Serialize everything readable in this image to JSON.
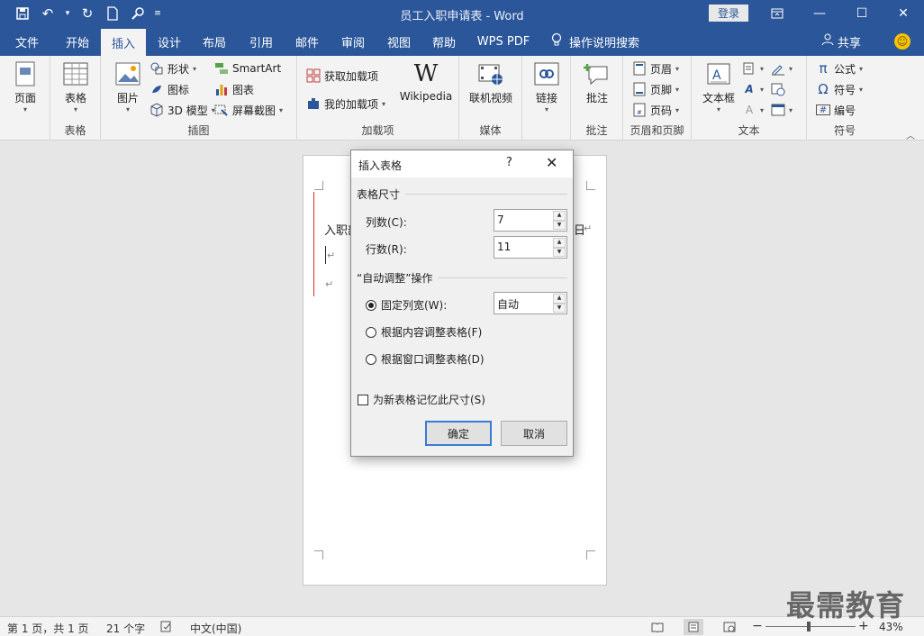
{
  "window": {
    "title": "员工入职申请表 - Word",
    "login_label": "登录"
  },
  "ribbon_tabs": [
    "文件",
    "开始",
    "插入",
    "设计",
    "布局",
    "引用",
    "邮件",
    "审阅",
    "视图",
    "帮助",
    "WPS PDF"
  ],
  "tell_me": "操作说明搜索",
  "share_label": "共享",
  "ribbon": {
    "pages": {
      "btn": "页面",
      "label": ""
    },
    "tables": {
      "btn": "表格",
      "label": "表格"
    },
    "illustrations": {
      "picture": "图片",
      "shapes": "形状",
      "icons": "图标",
      "model3d": "3D 模型",
      "smartart": "SmartArt",
      "chart": "图表",
      "screenshot": "屏幕截图",
      "label": "插图"
    },
    "addins": {
      "get": "获取加载项",
      "my": "我的加载项",
      "wikipedia": "Wikipedia",
      "label": "加载项"
    },
    "media": {
      "online_video": "联机视频",
      "label": "媒体"
    },
    "links": {
      "link": "链接"
    },
    "comments": {
      "comment": "批注",
      "label": "批注"
    },
    "header_footer": {
      "header": "页眉",
      "footer": "页脚",
      "page_number": "页码",
      "label": "页眉和页脚"
    },
    "text": {
      "textbox": "文本框",
      "label": "文本"
    },
    "symbols": {
      "equation": "公式",
      "symbol": "符号",
      "number": "编号",
      "label": "符号"
    }
  },
  "document": {
    "line1_start": "入职部",
    "line1_end": "日"
  },
  "dialog": {
    "title": "插入表格",
    "help": "?",
    "section_size": "表格尺寸",
    "columns_label": "列数(C):",
    "columns_value": "7",
    "rows_label": "行数(R):",
    "rows_value": "11",
    "section_autofit": "“自动调整”操作",
    "fixed_width_label": "固定列宽(W):",
    "fixed_width_value": "自动",
    "autofit_contents": "根据内容调整表格(F)",
    "autofit_window": "根据窗口调整表格(D)",
    "remember_label": "为新表格记忆此尺寸(S)",
    "ok": "确定",
    "cancel": "取消"
  },
  "statusbar": {
    "page": "第 1 页，共 1 页",
    "words": "21 个字",
    "language": "中文(中国)",
    "zoom": "43%"
  },
  "watermark": "最需教育"
}
